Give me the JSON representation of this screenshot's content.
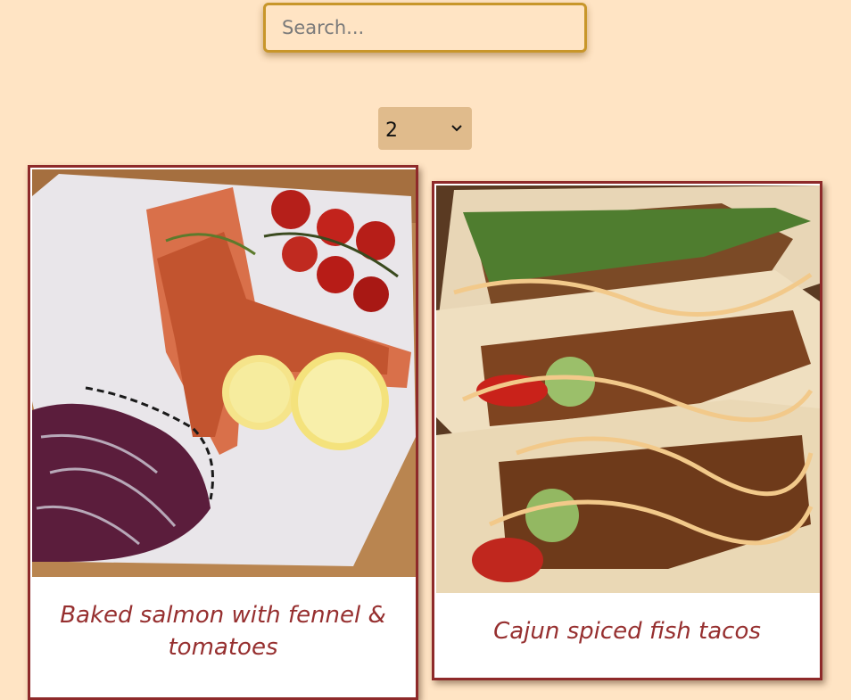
{
  "search": {
    "placeholder": "Search...",
    "value": ""
  },
  "per_page_select": {
    "selected": "2"
  },
  "recipes": [
    {
      "title": "Baked salmon with fennel & tomatoes"
    },
    {
      "title": "Cajun spiced fish tacos"
    }
  ],
  "colors": {
    "page_background": "#ffe4c4",
    "search_border": "#c8962a",
    "select_background": "#e0bb8c",
    "card_border": "#8e2a2a",
    "title_text": "#962f2f"
  },
  "icons": {
    "select_arrow": "chevron-down-icon"
  }
}
